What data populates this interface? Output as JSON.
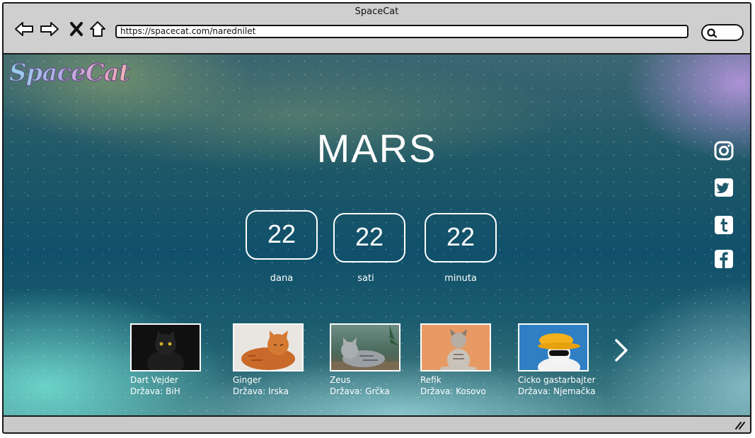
{
  "window": {
    "title": "SpaceCat"
  },
  "browser": {
    "url": "https://spacecat.com/narednilet",
    "nav_icons": [
      "back-arrow-icon",
      "forward-arrow-icon",
      "close-x-icon",
      "home-icon"
    ],
    "search_icon": "search-icon"
  },
  "page": {
    "logo_text": "SpaceCat",
    "planet": "MARS",
    "countdown": [
      {
        "value": "22",
        "label": "dana"
      },
      {
        "value": "22",
        "label": "sati"
      },
      {
        "value": "22",
        "label": "minuta"
      }
    ],
    "social": [
      "instagram-icon",
      "twitter-icon",
      "tumblr-icon",
      "facebook-icon"
    ],
    "cats": [
      {
        "name": "Dart Vejder",
        "country": "Država: BiH"
      },
      {
        "name": "Ginger",
        "country": "Država: Irska"
      },
      {
        "name": "Zeus",
        "country": "Država: Grčka"
      },
      {
        "name": "Refik",
        "country": "Država: Kosovo"
      },
      {
        "name": "Cicko gastarbajter",
        "country": "Država: Njemačka"
      }
    ],
    "next_icon": "chevron-right-icon"
  },
  "colors": {
    "accent_text": "#ffffff",
    "chrome": "#c9c9c9"
  }
}
